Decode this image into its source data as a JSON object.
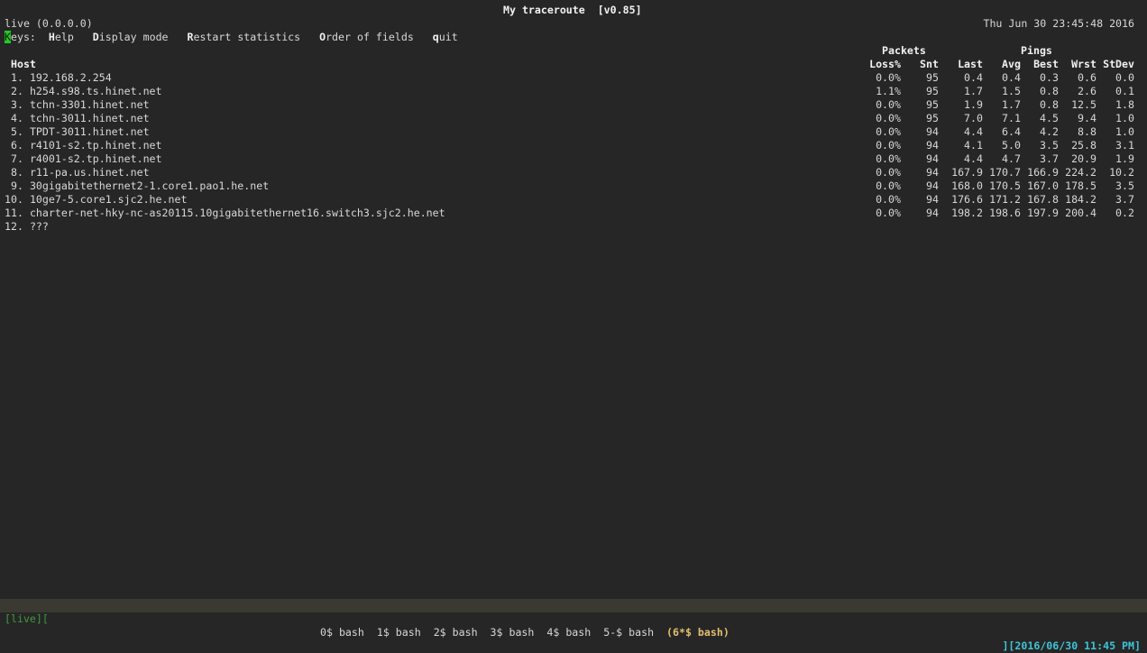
{
  "title": "My traceroute  [v0.85]",
  "host_line": "live (0.0.0.0)",
  "datetime": "Thu Jun 30 23:45:48 2016",
  "keys": {
    "label_first": "K",
    "label_rest": "eys:",
    "items": [
      {
        "key": "H",
        "rest": "elp"
      },
      {
        "key": "D",
        "rest": "isplay mode"
      },
      {
        "key": "R",
        "rest": "estart statistics"
      },
      {
        "key": "O",
        "rest": "rder of fields"
      },
      {
        "key": "q",
        "rest": "uit"
      }
    ]
  },
  "groups": {
    "packets": "Packets",
    "pings": "Pings"
  },
  "columns": [
    "Host",
    "Loss%",
    "Snt",
    "Last",
    "Avg",
    "Best",
    "Wrst",
    "StDev"
  ],
  "rows": [
    {
      "n": " 1.",
      "host": "192.168.2.254",
      "v": [
        "0.0%",
        "95",
        "0.4",
        "0.4",
        "0.3",
        "0.6",
        "0.0"
      ]
    },
    {
      "n": " 2.",
      "host": "h254.s98.ts.hinet.net",
      "v": [
        "1.1%",
        "95",
        "1.7",
        "1.5",
        "0.8",
        "2.6",
        "0.1"
      ]
    },
    {
      "n": " 3.",
      "host": "tchn-3301.hinet.net",
      "v": [
        "0.0%",
        "95",
        "1.9",
        "1.7",
        "0.8",
        "12.5",
        "1.8"
      ]
    },
    {
      "n": " 4.",
      "host": "tchn-3011.hinet.net",
      "v": [
        "0.0%",
        "95",
        "7.0",
        "7.1",
        "4.5",
        "9.4",
        "1.0"
      ]
    },
    {
      "n": " 5.",
      "host": "TPDT-3011.hinet.net",
      "v": [
        "0.0%",
        "94",
        "4.4",
        "6.4",
        "4.2",
        "8.8",
        "1.0"
      ]
    },
    {
      "n": " 6.",
      "host": "r4101-s2.tp.hinet.net",
      "v": [
        "0.0%",
        "94",
        "4.1",
        "5.0",
        "3.5",
        "25.8",
        "3.1"
      ]
    },
    {
      "n": " 7.",
      "host": "r4001-s2.tp.hinet.net",
      "v": [
        "0.0%",
        "94",
        "4.4",
        "4.7",
        "3.7",
        "20.9",
        "1.9"
      ]
    },
    {
      "n": " 8.",
      "host": "r11-pa.us.hinet.net",
      "v": [
        "0.0%",
        "94",
        "167.9",
        "170.7",
        "166.9",
        "224.2",
        "10.2"
      ]
    },
    {
      "n": " 9.",
      "host": "30gigabitethernet2-1.core1.pao1.he.net",
      "v": [
        "0.0%",
        "94",
        "168.0",
        "170.5",
        "167.0",
        "178.5",
        "3.5"
      ]
    },
    {
      "n": "10.",
      "host": "10ge7-5.core1.sjc2.he.net",
      "v": [
        "0.0%",
        "94",
        "176.6",
        "171.2",
        "167.8",
        "184.2",
        "3.7"
      ]
    },
    {
      "n": "11.",
      "host": "charter-net-hky-nc-as20115.10gigabitethernet16.switch3.sjc2.he.net",
      "v": [
        "0.0%",
        "94",
        "198.2",
        "198.6",
        "197.9",
        "200.4",
        "0.2"
      ]
    },
    {
      "n": "12.",
      "host": "???",
      "v": []
    }
  ],
  "status": {
    "session": "[live][",
    "windows": [
      "0$ bash",
      "1$ bash",
      "2$ bash",
      "3$ bash",
      "4$ bash",
      "5-$ bash"
    ],
    "active": "(6*$ bash)",
    "right": "][2016/06/30 11:45 PM]"
  }
}
